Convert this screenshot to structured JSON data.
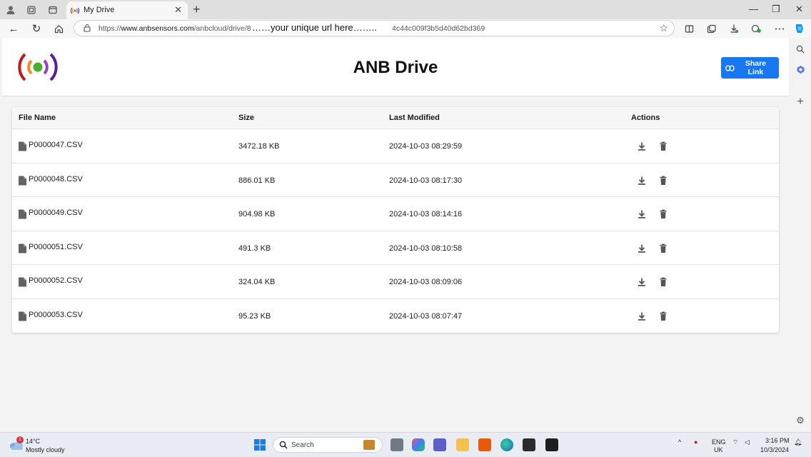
{
  "browser": {
    "tab_title": "My Drive",
    "url_prefix": "https://",
    "url_host": "www.anbsensors.com",
    "url_path": "/anbcloud/drive/8",
    "url_overlay": "……your unique url here……..",
    "url_suffix": "4c44c009f3b5d40d62bd369",
    "accent": "#1778f2"
  },
  "app": {
    "title": "ANB Drive",
    "share_label": "Share Link"
  },
  "table": {
    "columns": [
      "File Name",
      "Size",
      "Last Modified",
      "Actions"
    ],
    "rows": [
      {
        "name": "P0000047.CSV",
        "size": "3472.18 KB",
        "modified": "2024-10-03 08:29:59"
      },
      {
        "name": "P0000048.CSV",
        "size": "886.01 KB",
        "modified": "2024-10-03 08:17:30"
      },
      {
        "name": "P0000049.CSV",
        "size": "904.98 KB",
        "modified": "2024-10-03 08:14:16"
      },
      {
        "name": "P0000051.CSV",
        "size": "491.3 KB",
        "modified": "2024-10-03 08:10:58"
      },
      {
        "name": "P0000052.CSV",
        "size": "324.04 KB",
        "modified": "2024-10-03 08:09:06"
      },
      {
        "name": "P0000053.CSV",
        "size": "95.23 KB",
        "modified": "2024-10-03 08:07:47"
      }
    ]
  },
  "taskbar": {
    "weather_badge": "1",
    "temperature": "14°C",
    "weather": "Mostly cloudy",
    "search_label": "Search",
    "language": "ENG",
    "region": "UK",
    "time": "3:16 PM",
    "date": "10/3/2024"
  }
}
